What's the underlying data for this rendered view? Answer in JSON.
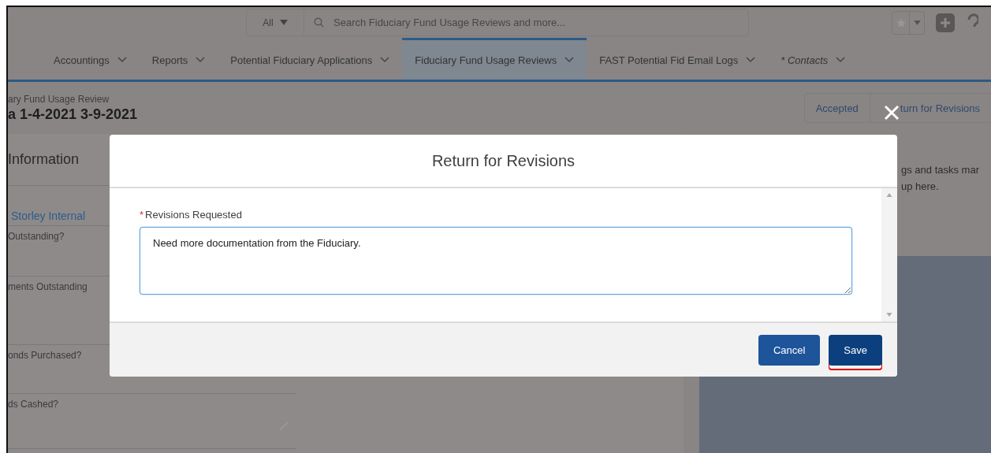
{
  "search": {
    "scope": "All",
    "placeholder": "Search Fiduciary Fund Usage Reviews and more..."
  },
  "nav_tabs": [
    {
      "label": "Accountings",
      "selected": false,
      "unsaved": false
    },
    {
      "label": "Reports",
      "selected": false,
      "unsaved": false
    },
    {
      "label": "Potential Fiduciary Applications",
      "selected": false,
      "unsaved": false
    },
    {
      "label": "Fiduciary Fund Usage Reviews",
      "selected": true,
      "unsaved": false
    },
    {
      "label": "FAST Potential Fid Email Logs",
      "selected": false,
      "unsaved": false
    },
    {
      "label": "* Contacts",
      "selected": false,
      "unsaved": true
    }
  ],
  "record": {
    "type": "ary Fund Usage Review",
    "title": "a 1-4-2021 3-9-2021",
    "actions": [
      "Accepted",
      "turn for Revisions"
    ]
  },
  "details": {
    "title": "Information",
    "link": "Storley Internal",
    "fields": [
      "Outstanding?",
      "ments Outstanding",
      "onds Purchased?",
      "ds Cashed?"
    ]
  },
  "activity": {
    "lines": [
      "gs and tasks mar",
      "up here."
    ]
  },
  "modal": {
    "title": "Return for Revisions",
    "field": {
      "label": "Revisions Requested",
      "required": true,
      "required_mark": "*",
      "value": "Need more documentation from the Fiduciary."
    },
    "buttons": [
      {
        "label": "Cancel",
        "focused": false,
        "underlined": false
      },
      {
        "label": "Save",
        "focused": true,
        "underlined": true
      }
    ]
  }
}
